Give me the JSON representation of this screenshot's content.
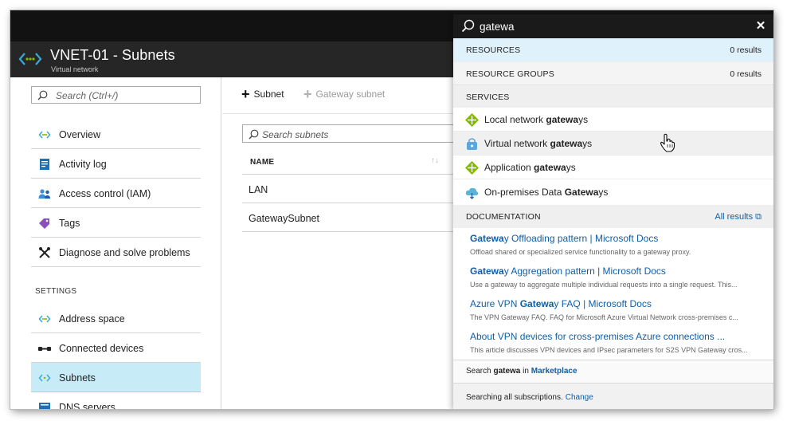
{
  "blade": {
    "title": "VNET-01 - Subnets",
    "subtitle": "Virtual network"
  },
  "nav": {
    "search_placeholder": "Search (Ctrl+/)",
    "items": [
      {
        "label": "Overview",
        "icon": "vnet-overview-icon"
      },
      {
        "label": "Activity log",
        "icon": "activity-log-icon"
      },
      {
        "label": "Access control (IAM)",
        "icon": "iam-users-icon"
      },
      {
        "label": "Tags",
        "icon": "tag-icon"
      },
      {
        "label": "Diagnose and solve problems",
        "icon": "wrench-icon"
      }
    ],
    "settings_header": "SETTINGS",
    "settings_items": [
      {
        "label": "Address space",
        "icon": "address-space-icon"
      },
      {
        "label": "Connected devices",
        "icon": "connected-devices-icon"
      },
      {
        "label": "Subnets",
        "icon": "subnet-icon",
        "active": true
      },
      {
        "label": "DNS servers",
        "icon": "dns-icon"
      }
    ]
  },
  "toolbar": {
    "subnet_label": "Subnet",
    "gateway_subnet_label": "Gateway subnet"
  },
  "subnets": {
    "search_placeholder": "Search subnets",
    "column_name": "NAME",
    "rows": [
      "LAN",
      "GatewaySubnet"
    ]
  },
  "search": {
    "query": "gatewa",
    "resources_label": "RESOURCES",
    "resources_count": "0 results",
    "resource_groups_label": "RESOURCE GROUPS",
    "resource_groups_count": "0 results",
    "services_label": "SERVICES",
    "services": [
      {
        "prefix": "Local network ",
        "match": "gatewa",
        "suffix": "ys",
        "icon": "local-network-gateway-icon"
      },
      {
        "prefix": "Virtual network ",
        "match": "gatewa",
        "suffix": "ys",
        "icon": "virtual-network-gateway-icon"
      },
      {
        "prefix": "Application ",
        "match": "gatewa",
        "suffix": "ys",
        "icon": "application-gateway-icon"
      },
      {
        "prefix": "On-premises Data ",
        "match": "Gatewa",
        "suffix": "ys",
        "icon": "data-gateway-cloud-icon"
      }
    ],
    "documentation_label": "DOCUMENTATION",
    "all_results_label": "All results",
    "docs": [
      {
        "prefix": "",
        "match": "Gatewa",
        "suffix": "y Offloading pattern | Microsoft Docs",
        "desc": "Offload shared or specialized service functionality to a gateway proxy."
      },
      {
        "prefix": "",
        "match": "Gatewa",
        "suffix": "y Aggregation pattern | Microsoft Docs",
        "desc": "Use a gateway to aggregate multiple individual requests into a single request. This..."
      },
      {
        "prefix": "Azure VPN ",
        "match": "Gatewa",
        "suffix": "y FAQ | Microsoft Docs",
        "desc": "The VPN Gateway FAQ. FAQ for Microsoft Azure Virtual Network cross-premises c..."
      },
      {
        "prefix": "About VPN devices for cross-premises Azure connections ...",
        "match": "",
        "suffix": "",
        "desc": "This article discusses VPN devices and IPsec parameters for S2S VPN Gateway cros..."
      }
    ],
    "marketplace_prefix": "Search",
    "marketplace_term": "gatewa",
    "marketplace_in": "in",
    "marketplace_link": "Marketplace",
    "footer_text": "Searching all subscriptions.",
    "footer_link": "Change"
  },
  "colors": {
    "accent": "#0f5ea9",
    "active_nav": "#c7ecf7",
    "resources_highlight": "#dff1fa",
    "gateway_green": "#7fba00"
  }
}
